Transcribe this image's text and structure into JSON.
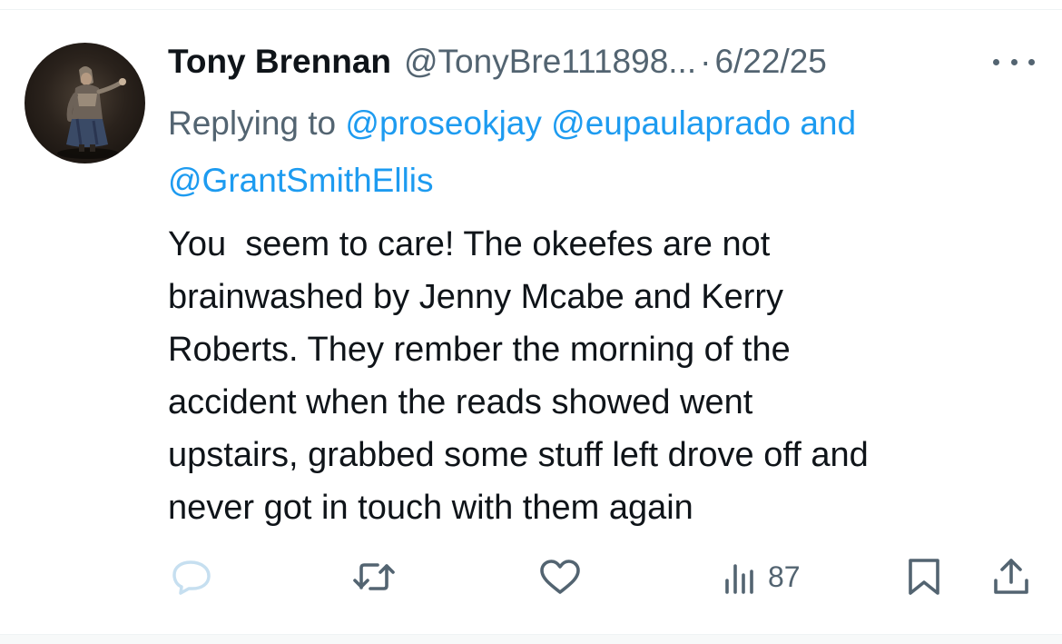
{
  "tweet": {
    "author_name": "Tony Brennan",
    "author_handle": "@TonyBre111898...",
    "separator": "·",
    "date": "6/22/25",
    "replying_prefix": "Replying to",
    "mentions": [
      "@proseokjay",
      "@eupaulaprado",
      "and",
      "@GrantSmithEllis"
    ],
    "text_lines": [
      "You  seem to care! The okeefes are not",
      "brainwashed by Jenny Mcabe and Kerry",
      "Roberts. They rember the morning of the",
      "accident when the reads showed went",
      "upstairs, grabbed some stuff left drove off and",
      "never got in touch with them again"
    ]
  },
  "actions": {
    "reply_icon": "reply-icon",
    "retweet_icon": "retweet-icon",
    "like_icon": "heart-icon",
    "views_icon": "views-icon",
    "views_count": "87",
    "bookmark_icon": "bookmark-icon",
    "share_icon": "share-icon"
  },
  "colors": {
    "text": "#0f1419",
    "secondary": "#536471",
    "link": "#1d9bf0",
    "reply_icon_faded": "#c6dff0"
  }
}
